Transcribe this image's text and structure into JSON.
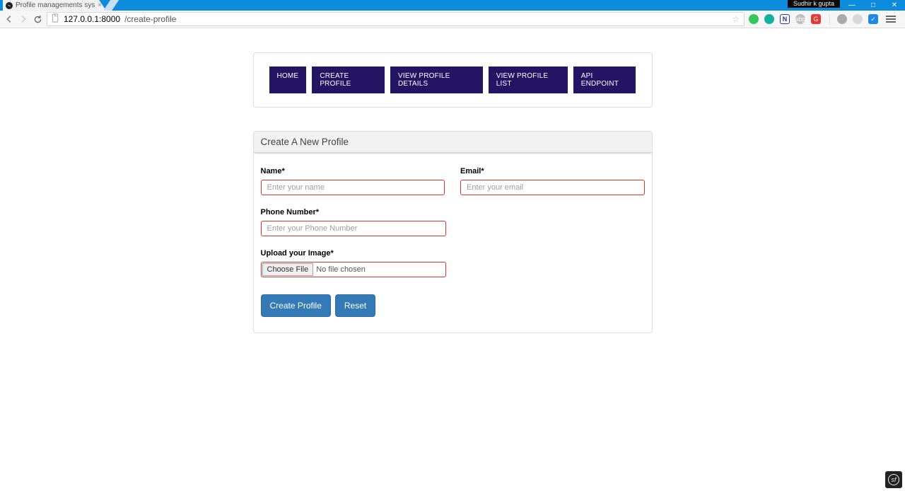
{
  "browser": {
    "tab_title": "Profile managements sys",
    "user_badge": "Sudhir k gupta",
    "url_host": "127.0.0.1",
    "url_port": ":8000",
    "url_path": "/create-profile"
  },
  "nav": {
    "home": "HOME",
    "create_profile": "CREATE PROFILE",
    "view_details": "VIEW PROFILE DETAILS",
    "view_list": "VIEW PROFILE LIST",
    "api_endpoint": "API ENDPOINT"
  },
  "panel": {
    "title": "Create A New Profile"
  },
  "form": {
    "name_label": "Name*",
    "name_placeholder": "Enter your name",
    "email_label": "Email*",
    "email_placeholder": "Enter your email",
    "phone_label": "Phone Number*",
    "phone_placeholder": "Enter your Phone Number",
    "image_label": "Upload your Image*",
    "choose_file": "Choose File",
    "no_file": "No file chosen",
    "submit": "Create Profile",
    "reset": "Reset"
  }
}
